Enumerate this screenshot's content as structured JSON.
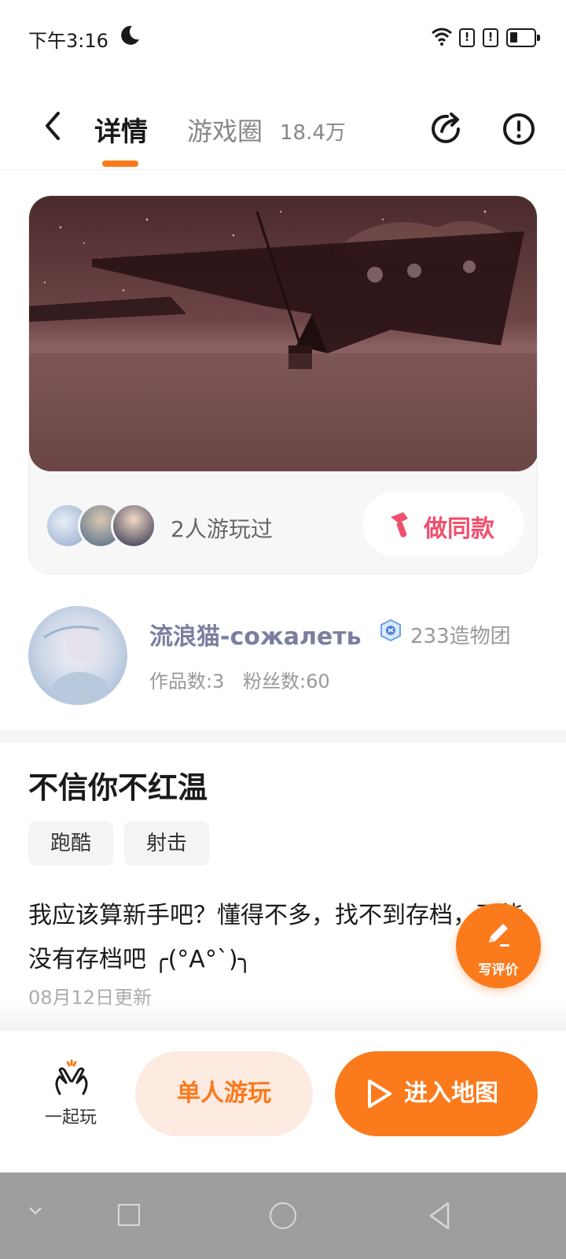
{
  "status_bar": {
    "time": "下午3:16",
    "icons": [
      "moon-icon",
      "wifi-icon",
      "alert-icon",
      "alert-icon",
      "battery-icon"
    ]
  },
  "header": {
    "tab_detail": "详情",
    "tab_circle": "游戏圈",
    "circle_count": "18.4万",
    "icons": [
      "back-icon",
      "share-icon",
      "report-icon"
    ]
  },
  "cover": {
    "played_text": "2人游玩过",
    "make_same_label": "做同款"
  },
  "author": {
    "name": "流浪猫-сожалеть",
    "team": "233造物团",
    "works": "作品数:3",
    "fans": "粉丝数:60"
  },
  "game": {
    "title": "不信你不红温",
    "tags": [
      "跑酷",
      "射击"
    ],
    "description": "我应该算新手吧？懂得不多，找不到存档，可能没有存档吧 ╭(°A°`)╮",
    "updated": "08月12日更新"
  },
  "review_fab": {
    "label": "写评价"
  },
  "actions": {
    "play_together": "一起玩",
    "solo": "单人游玩",
    "enter": "进入地图"
  },
  "colors": {
    "accent": "#fa7a1c",
    "make_same": "#f0506e",
    "author_name": "#7a7fa0"
  }
}
